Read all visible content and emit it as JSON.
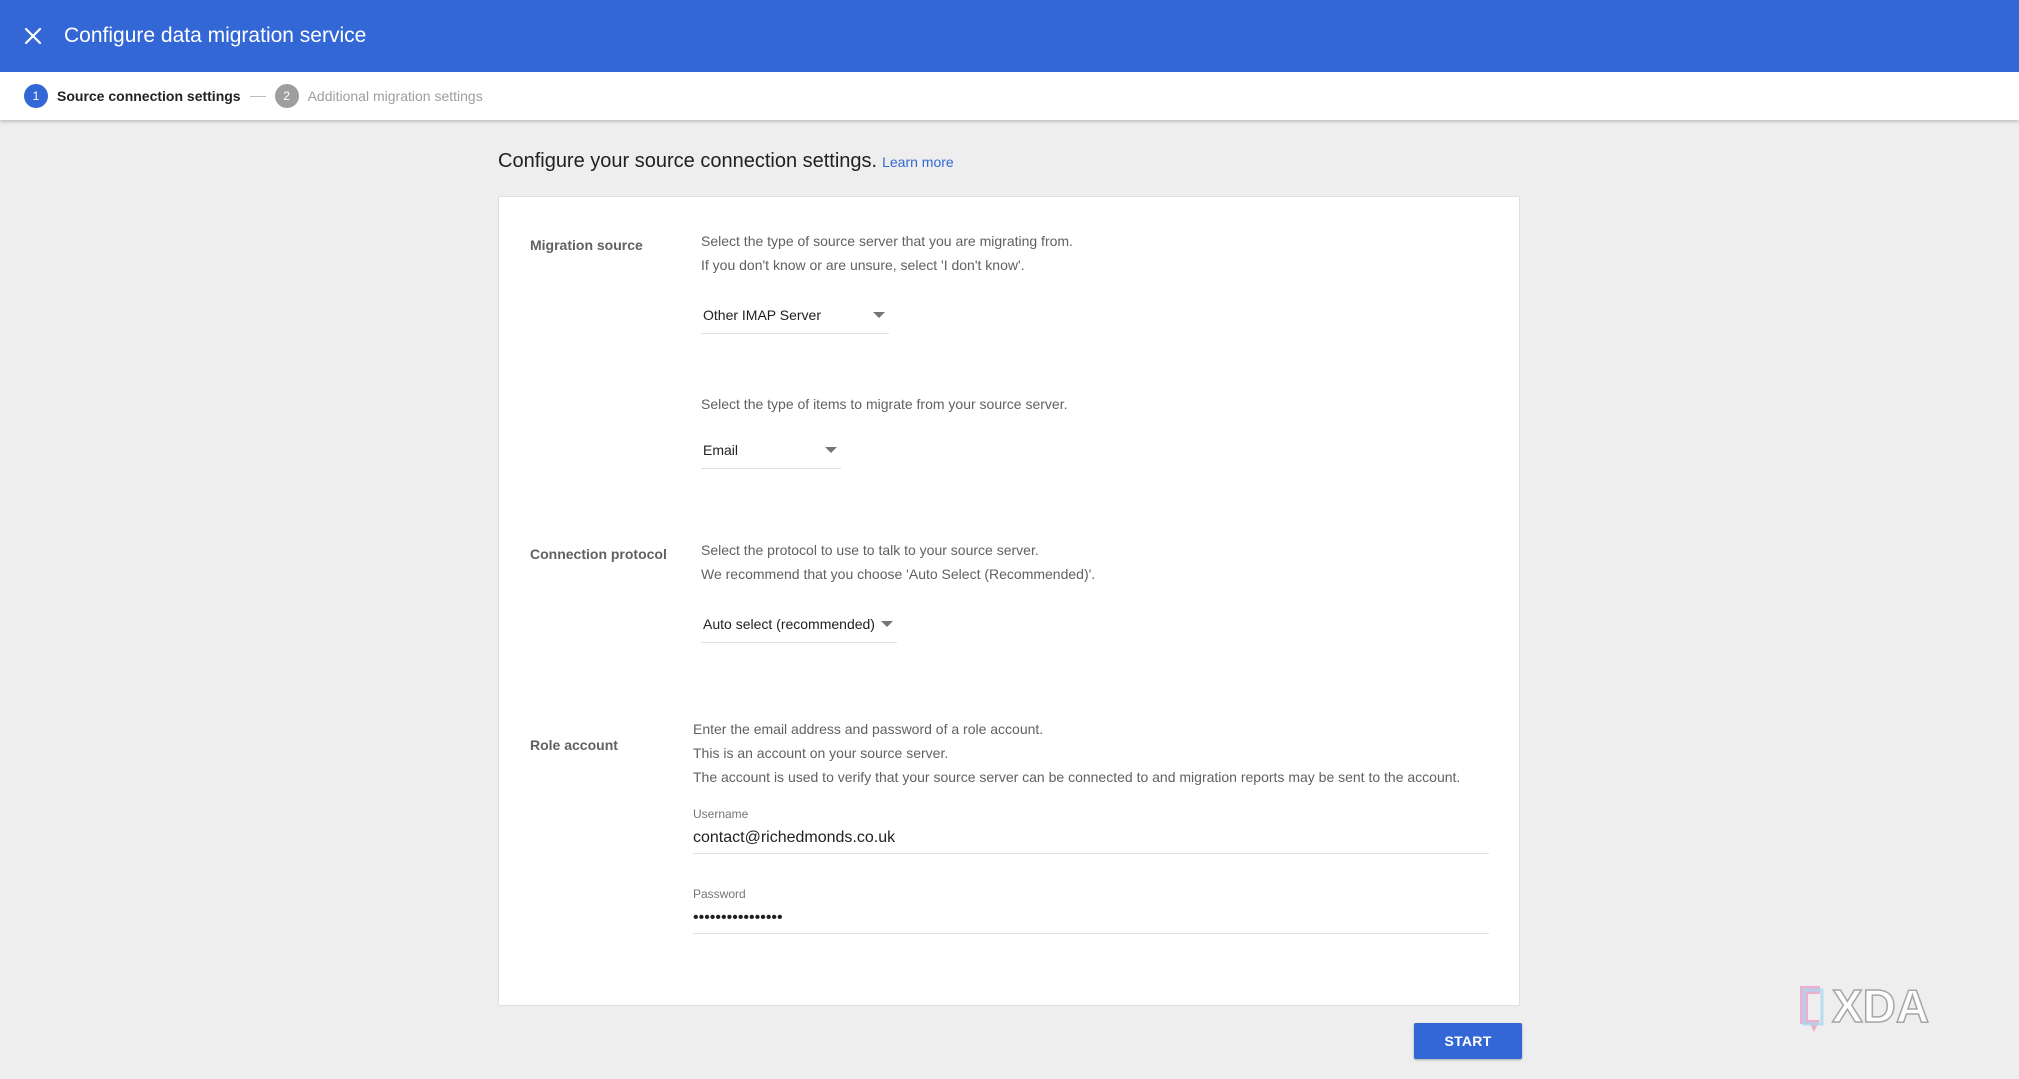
{
  "header": {
    "title": "Configure data migration service"
  },
  "stepper": {
    "steps": [
      {
        "number": "1",
        "label": "Source connection settings"
      },
      {
        "number": "2",
        "label": "Additional migration settings"
      }
    ]
  },
  "page": {
    "heading": "Configure your source connection settings.",
    "learn_more": "Learn more"
  },
  "migration_source": {
    "label": "Migration source",
    "help_line1": "Select the type of source server that you are migrating from.",
    "help_line2": "If you don't know or are unsure, select 'I don't know'.",
    "selected": "Other IMAP Server"
  },
  "items": {
    "help": "Select the type of items to migrate from your source server.",
    "selected": "Email"
  },
  "connection_protocol": {
    "label": "Connection protocol",
    "help_line1": "Select the protocol to use to talk to your source server.",
    "help_line2": "We recommend that you choose 'Auto Select (Recommended)'.",
    "selected": "Auto select (recommended)"
  },
  "role_account": {
    "label": "Role account",
    "help_line1": "Enter the email address and password of a role account.",
    "help_line2": "This is an account on your source server.",
    "help_line3": "The account is used to verify that your source server can be connected to and migration reports may be sent to the account.",
    "username_label": "Username",
    "username_value": "contact@richedmonds.co.uk",
    "password_label": "Password",
    "password_value": "••••••••••••••••"
  },
  "actions": {
    "start": "START"
  },
  "watermark": {
    "text": "XDA"
  }
}
